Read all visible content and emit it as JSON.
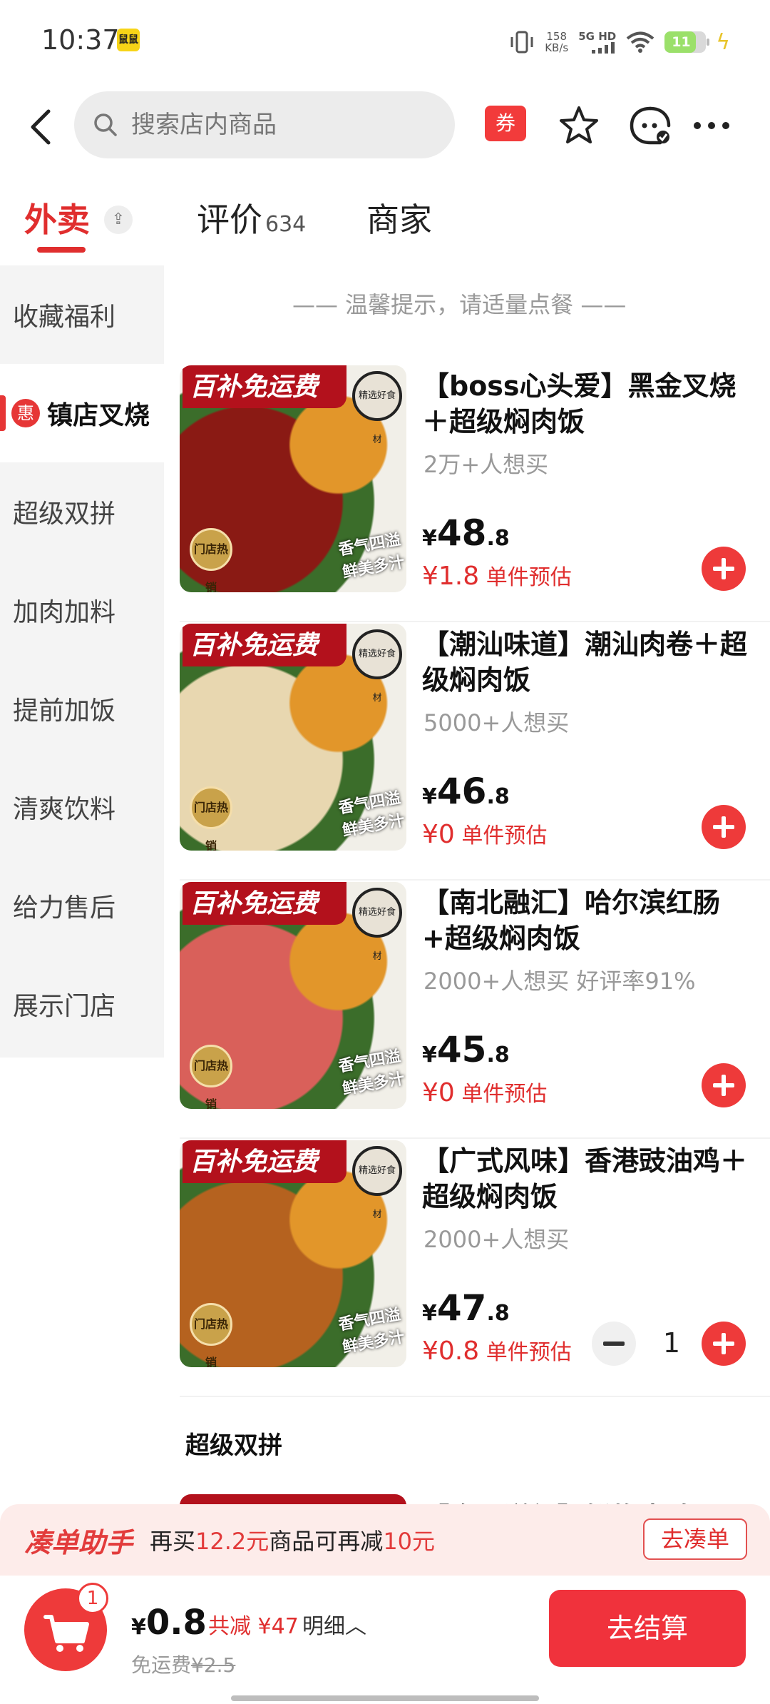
{
  "status_bar": {
    "time": "10:37",
    "app_badge": "鼠鼠",
    "net_speed_value": "158",
    "net_speed_unit": "KB/s",
    "net_type": "5G HD",
    "battery": "11"
  },
  "top_nav": {
    "search_placeholder": "搜索店内商品",
    "coupon_label": "券"
  },
  "tabs": {
    "waimai": "外卖",
    "pingjia": "评价",
    "pingjia_count": "634",
    "shangjia": "商家",
    "collapse_symbol": "⇪"
  },
  "sidebar": {
    "items": [
      {
        "label": "收藏福利"
      },
      {
        "label": "镇店叉烧",
        "badge": "惠"
      },
      {
        "label": "超级双拼"
      },
      {
        "label": "加肉加料"
      },
      {
        "label": "提前加饭"
      },
      {
        "label": "清爽饮料"
      },
      {
        "label": "给力售后"
      },
      {
        "label": "展示门店"
      }
    ]
  },
  "tip": "—— 温馨提示，请适量点餐 ——",
  "image_overlay": {
    "banner": "百补免运费",
    "seal": "精选好食材",
    "medal": "门店热销",
    "stamp_line1": "香气四溢",
    "stamp_line2": "鲜美多汁"
  },
  "products": [
    {
      "title": "【boss心头爱】黑金叉烧＋超级焖肉饭",
      "sales": "2万+人想买",
      "price_yen": "¥",
      "price_int": "48",
      "price_dec": ".8",
      "est_val": "¥1.8",
      "est_label": "单件预估",
      "img_color": "#8a1a14"
    },
    {
      "title": "【潮汕味道】潮汕肉卷＋超级焖肉饭",
      "sales": "5000+人想买",
      "price_yen": "¥",
      "price_int": "46",
      "price_dec": ".8",
      "est_val": "¥0",
      "est_label": "单件预估",
      "img_color": "#e8d7b0"
    },
    {
      "title": "【南北融汇】哈尔滨红肠+超级焖肉饭",
      "sales": "2000+人想买 好评率91%",
      "price_yen": "¥",
      "price_int": "45",
      "price_dec": ".8",
      "est_val": "¥0",
      "est_label": "单件预估",
      "img_color": "#d9605a"
    },
    {
      "title": "【广式风味】香港豉油鸡＋超级焖肉饭",
      "sales": "2000+人想买",
      "price_yen": "¥",
      "price_int": "47",
      "price_dec": ".8",
      "est_val": "¥0.8",
      "est_label": "单件预估",
      "img_color": "#b5621f",
      "quantity": "1"
    }
  ],
  "section_title": "超级双拼",
  "peek_title": "【金丽洋红】鲜炸牛腩＋",
  "assist": {
    "label": "凑单助手",
    "text_pre": "再买",
    "amount": "12.2元",
    "text_mid": "商品可再减",
    "discount": "10元",
    "button": "去凑单"
  },
  "cart": {
    "badge": "1",
    "yen": "¥",
    "amount": "0.8",
    "discount_text": "共减 ¥47",
    "detail": "明细︿",
    "shipping_label": "免运费",
    "shipping_original": "¥2.5",
    "checkout": "去结算"
  },
  "colors": {
    "accent": "#e02e2e",
    "cart_red": "#ee3a3a",
    "checkout_red": "#f0323c"
  }
}
